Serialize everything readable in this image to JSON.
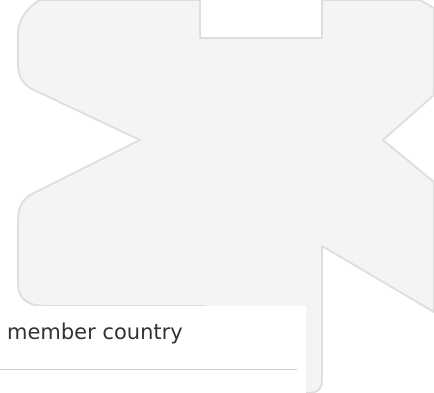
{
  "emblem": {
    "icon": "asterisk-star-shape",
    "fill_color": "#f4f4f4",
    "stroke_color": "#dedede"
  },
  "field": {
    "label": "member country"
  }
}
